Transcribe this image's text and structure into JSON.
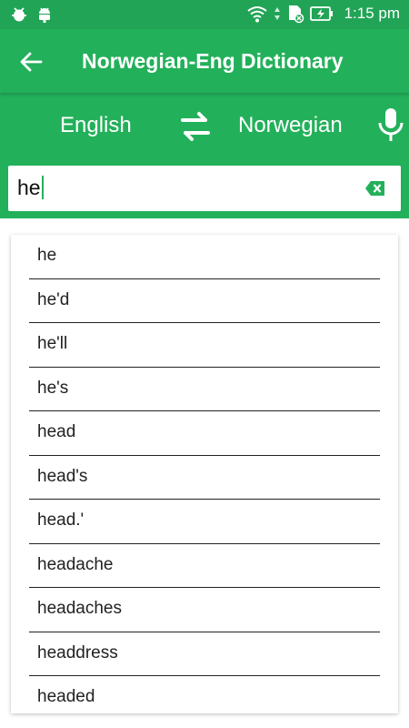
{
  "status_bar": {
    "time": "1:15 pm",
    "icons": [
      "bug-icon",
      "android-icon",
      "wifi-icon",
      "data-arrows-icon",
      "sd-card-icon",
      "battery-charging-icon"
    ]
  },
  "app_bar": {
    "title": "Norwegian-Eng Dictionary",
    "back_icon": "arrow-left-icon"
  },
  "languages": {
    "source": "English",
    "target": "Norwegian",
    "swap_icon": "swap-arrows-icon",
    "mic_icon": "microphone-icon"
  },
  "search": {
    "value": "he",
    "clear_icon": "backspace-icon"
  },
  "suggestions": [
    "he",
    "he'd",
    "he'll",
    "he's",
    "head",
    "head's",
    "head.'",
    "headache",
    "headaches",
    "headdress",
    "headed"
  ],
  "colors": {
    "primary": "#23b05a",
    "status_bar": "#21a456"
  }
}
